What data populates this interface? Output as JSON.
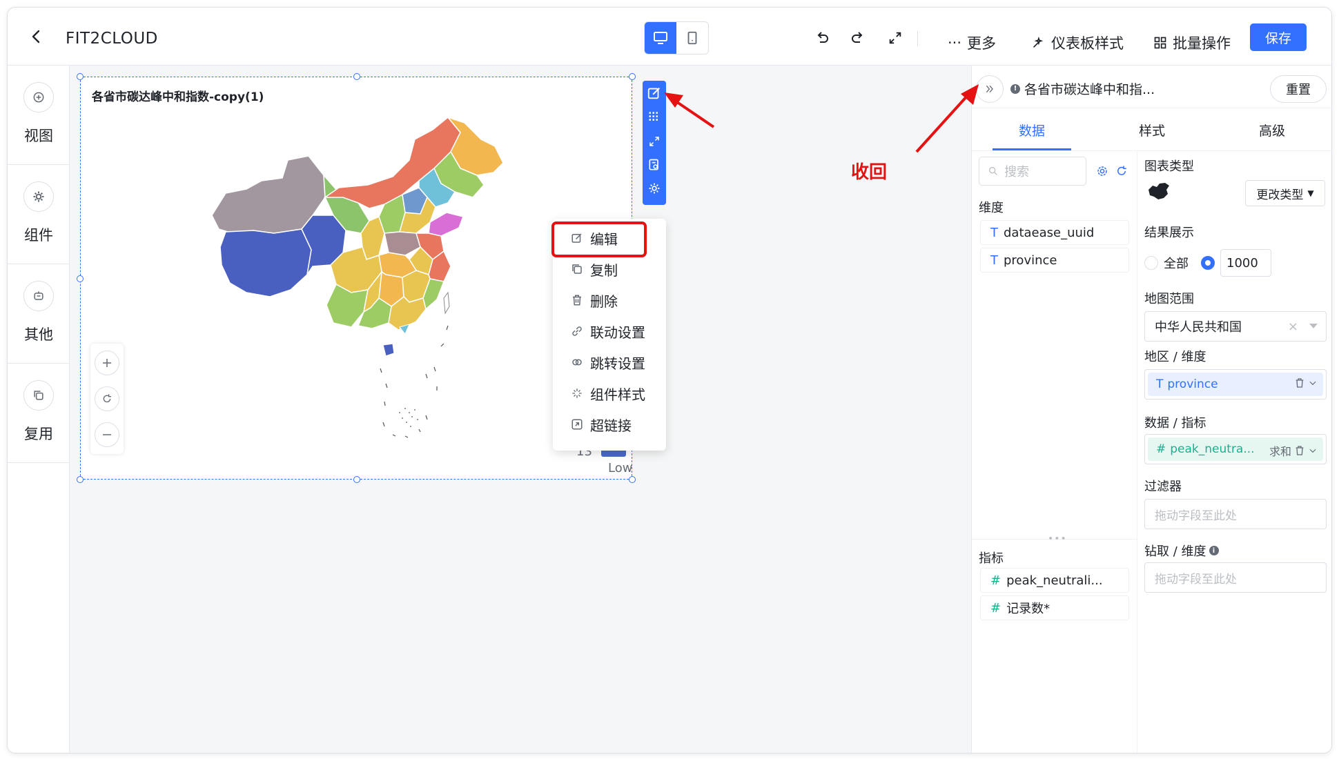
{
  "header": {
    "app_title": "FIT2CLOUD",
    "more_label": "更多",
    "dashboard_style_label": "仪表板样式",
    "batch_label": "批量操作",
    "save_label": "保存"
  },
  "sidebar": {
    "items": [
      {
        "label": "视图",
        "icon": "plus-circle-icon"
      },
      {
        "label": "组件",
        "icon": "gear-icon"
      },
      {
        "label": "其他",
        "icon": "bot-icon"
      },
      {
        "label": "复用",
        "icon": "copy-icon"
      }
    ]
  },
  "widget": {
    "title": "各省市碳达峰中和指数-copy(1)",
    "legend_value": "13",
    "legend_low": "Low"
  },
  "context_menu": {
    "items": [
      {
        "label": "编辑",
        "icon": "edit-icon"
      },
      {
        "label": "复制",
        "icon": "duplicate-icon"
      },
      {
        "label": "删除",
        "icon": "trash-icon"
      },
      {
        "label": "联动设置",
        "icon": "link-icon"
      },
      {
        "label": "跳转设置",
        "icon": "jump-icon"
      },
      {
        "label": "组件样式",
        "icon": "sparkle-icon"
      },
      {
        "label": "超链接",
        "icon": "hyperlink-icon"
      }
    ]
  },
  "annotation": {
    "collapse_label": "收回",
    "color": "#e41212"
  },
  "right_panel": {
    "title": "各省市碳达峰中和指...",
    "reset_label": "重置",
    "tabs": [
      "数据",
      "样式",
      "高级"
    ],
    "search_placeholder": "搜索",
    "dimension_label": "维度",
    "dimension_fields": [
      "dataease_uuid",
      "province"
    ],
    "measure_label": "指标",
    "measure_fields": [
      "peak_neutrali...",
      "记录数*"
    ],
    "chart_type_label": "图表类型",
    "change_type_label": "更改类型",
    "result_label": "结果展示",
    "result_all": "全部",
    "result_limit": "1000",
    "map_range_label": "地图范围",
    "map_range_value": "中华人民共和国",
    "area_dim_label": "地区 / 维度",
    "area_dim_value": "province",
    "data_metric_label": "数据 / 指标",
    "data_metric_value": "peak_neutra...",
    "data_metric_agg": "求和",
    "filter_label": "过滤器",
    "drop_placeholder": "拖动字段至此处",
    "drill_label": "钻取 / 维度"
  },
  "colors": {
    "accent": "#3370ff",
    "dimension": "#3370ff",
    "measure": "#1bb18e"
  }
}
